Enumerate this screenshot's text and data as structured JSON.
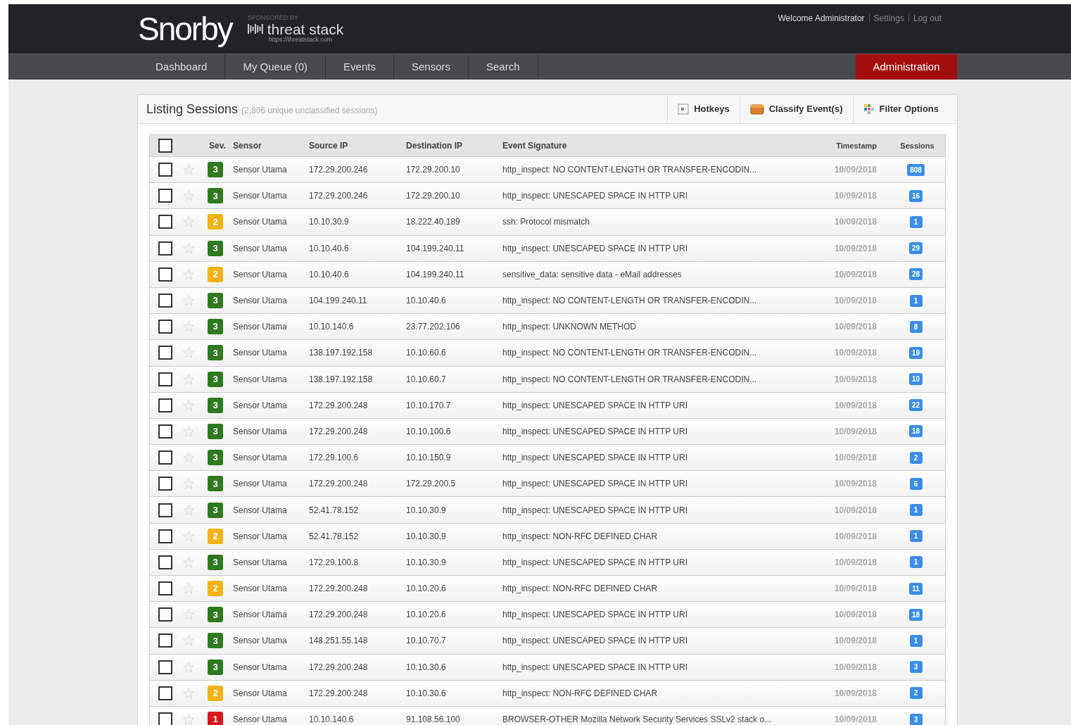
{
  "header": {
    "logo": "Snorby",
    "sponsor_caption": "SPONSORED BY",
    "sponsor_name": "threat stack",
    "sponsor_url": "https://threatstack.com",
    "user_links": [
      "Welcome Administrator",
      "Settings",
      "Log out"
    ]
  },
  "nav": [
    {
      "label": "Dashboard",
      "kind": "tab"
    },
    {
      "label": "My Queue (0)",
      "kind": "tab"
    },
    {
      "label": "Events",
      "kind": "tab"
    },
    {
      "label": "Sensors",
      "kind": "tab"
    },
    {
      "label": "Search",
      "kind": "tab"
    },
    {
      "label": "Administration",
      "kind": "admin"
    }
  ],
  "panel": {
    "title": "Listing Sessions",
    "subtitle": "(2,806 unique unclassified sessions)",
    "actions": [
      {
        "label": "Hotkeys",
        "kind": "hotkeys"
      },
      {
        "label": "Classify Event(s)",
        "kind": "classify"
      },
      {
        "label": "Filter Options",
        "kind": "filter"
      }
    ]
  },
  "table": {
    "select_all_checked": false,
    "columns": [
      "Sev.",
      "Sensor",
      "Source IP",
      "Destination IP",
      "Event Signature",
      "Timestamp",
      "Sessions"
    ],
    "rows": [
      {
        "checked": false,
        "starred": false,
        "severity": {
          "label": "3",
          "color": "#2f7a1f"
        },
        "sensor": "Sensor Utama",
        "source": "172.29.200.246",
        "destination": "172.29.200.10",
        "signature": "http_inspect: NO CONTENT-LENGTH OR TRANSFER-ENCODIN...",
        "timestamp": "10/09/2018",
        "sessions": "808"
      },
      {
        "checked": false,
        "starred": false,
        "severity": {
          "label": "3",
          "color": "#2f7a1f"
        },
        "sensor": "Sensor Utama",
        "source": "172.29.200.246",
        "destination": "172.29.200.10",
        "signature": "http_inspect: UNESCAPED SPACE IN HTTP URI",
        "timestamp": "10/09/2018",
        "sessions": "16"
      },
      {
        "checked": false,
        "starred": false,
        "severity": {
          "label": "2",
          "color": "#f2b318"
        },
        "sensor": "Sensor Utama",
        "source": "10.10.30.9",
        "destination": "18.222.40.189",
        "signature": "ssh: Protocol mismatch",
        "timestamp": "10/09/2018",
        "sessions": "1"
      },
      {
        "checked": false,
        "starred": false,
        "severity": {
          "label": "3",
          "color": "#2f7a1f"
        },
        "sensor": "Sensor Utama",
        "source": "10.10.40.6",
        "destination": "104.199.240.11",
        "signature": "http_inspect: UNESCAPED SPACE IN HTTP URI",
        "timestamp": "10/09/2018",
        "sessions": "29"
      },
      {
        "checked": false,
        "starred": false,
        "severity": {
          "label": "2",
          "color": "#f2b318"
        },
        "sensor": "Sensor Utama",
        "source": "10.10.40.6",
        "destination": "104.199.240.11",
        "signature": "sensitive_data: sensitive data - eMail addresses",
        "timestamp": "10/09/2018",
        "sessions": "28"
      },
      {
        "checked": false,
        "starred": false,
        "severity": {
          "label": "3",
          "color": "#2f7a1f"
        },
        "sensor": "Sensor Utama",
        "source": "104.199.240.11",
        "destination": "10.10.40.6",
        "signature": "http_inspect: NO CONTENT-LENGTH OR TRANSFER-ENCODIN...",
        "timestamp": "10/09/2018",
        "sessions": "1"
      },
      {
        "checked": false,
        "starred": false,
        "severity": {
          "label": "3",
          "color": "#2f7a1f"
        },
        "sensor": "Sensor Utama",
        "source": "10.10.140.6",
        "destination": "23.77.202.106",
        "signature": "http_inspect: UNKNOWN METHOD",
        "timestamp": "10/09/2018",
        "sessions": "8"
      },
      {
        "checked": false,
        "starred": false,
        "severity": {
          "label": "3",
          "color": "#2f7a1f"
        },
        "sensor": "Sensor Utama",
        "source": "138.197.192.158",
        "destination": "10.10.60.6",
        "signature": "http_inspect: NO CONTENT-LENGTH OR TRANSFER-ENCODIN...",
        "timestamp": "10/09/2018",
        "sessions": "19"
      },
      {
        "checked": false,
        "starred": false,
        "severity": {
          "label": "3",
          "color": "#2f7a1f"
        },
        "sensor": "Sensor Utama",
        "source": "138.197.192.158",
        "destination": "10.10.60.7",
        "signature": "http_inspect: NO CONTENT-LENGTH OR TRANSFER-ENCODIN...",
        "timestamp": "10/09/2018",
        "sessions": "10"
      },
      {
        "checked": false,
        "starred": false,
        "severity": {
          "label": "3",
          "color": "#2f7a1f"
        },
        "sensor": "Sensor Utama",
        "source": "172.29.200.248",
        "destination": "10.10.170.7",
        "signature": "http_inspect: UNESCAPED SPACE IN HTTP URI",
        "timestamp": "10/09/2018",
        "sessions": "22"
      },
      {
        "checked": false,
        "starred": false,
        "severity": {
          "label": "3",
          "color": "#2f7a1f"
        },
        "sensor": "Sensor Utama",
        "source": "172.29.200.248",
        "destination": "10.10.100.6",
        "signature": "http_inspect: UNESCAPED SPACE IN HTTP URI",
        "timestamp": "10/09/2018",
        "sessions": "18"
      },
      {
        "checked": false,
        "starred": false,
        "severity": {
          "label": "3",
          "color": "#2f7a1f"
        },
        "sensor": "Sensor Utama",
        "source": "172.29.100.6",
        "destination": "10.10.150.9",
        "signature": "http_inspect: UNESCAPED SPACE IN HTTP URI",
        "timestamp": "10/09/2018",
        "sessions": "2"
      },
      {
        "checked": false,
        "starred": false,
        "severity": {
          "label": "3",
          "color": "#2f7a1f"
        },
        "sensor": "Sensor Utama",
        "source": "172.29.200.248",
        "destination": "172.29.200.5",
        "signature": "http_inspect: UNESCAPED SPACE IN HTTP URI",
        "timestamp": "10/09/2018",
        "sessions": "6"
      },
      {
        "checked": false,
        "starred": false,
        "severity": {
          "label": "3",
          "color": "#2f7a1f"
        },
        "sensor": "Sensor Utama",
        "source": "52.41.78.152",
        "destination": "10.10.30.9",
        "signature": "http_inspect: UNESCAPED SPACE IN HTTP URI",
        "timestamp": "10/09/2018",
        "sessions": "1"
      },
      {
        "checked": false,
        "starred": false,
        "severity": {
          "label": "2",
          "color": "#f2b318"
        },
        "sensor": "Sensor Utama",
        "source": "52.41.78.152",
        "destination": "10.10.30.9",
        "signature": "http_inspect: NON-RFC DEFINED CHAR",
        "timestamp": "10/09/2018",
        "sessions": "1"
      },
      {
        "checked": false,
        "starred": false,
        "severity": {
          "label": "3",
          "color": "#2f7a1f"
        },
        "sensor": "Sensor Utama",
        "source": "172.29.100.8",
        "destination": "10.10.30.9",
        "signature": "http_inspect: UNESCAPED SPACE IN HTTP URI",
        "timestamp": "10/09/2018",
        "sessions": "1"
      },
      {
        "checked": false,
        "starred": false,
        "severity": {
          "label": "2",
          "color": "#f2b318"
        },
        "sensor": "Sensor Utama",
        "source": "172.29.200.248",
        "destination": "10.10.20.6",
        "signature": "http_inspect: NON-RFC DEFINED CHAR",
        "timestamp": "10/09/2018",
        "sessions": "11"
      },
      {
        "checked": false,
        "starred": false,
        "severity": {
          "label": "3",
          "color": "#2f7a1f"
        },
        "sensor": "Sensor Utama",
        "source": "172.29.200.248",
        "destination": "10.10.20.6",
        "signature": "http_inspect: UNESCAPED SPACE IN HTTP URI",
        "timestamp": "10/09/2018",
        "sessions": "18"
      },
      {
        "checked": false,
        "starred": false,
        "severity": {
          "label": "3",
          "color": "#2f7a1f"
        },
        "sensor": "Sensor Utama",
        "source": "148.251.55.148",
        "destination": "10.10.70.7",
        "signature": "http_inspect: UNESCAPED SPACE IN HTTP URI",
        "timestamp": "10/09/2018",
        "sessions": "1"
      },
      {
        "checked": false,
        "starred": false,
        "severity": {
          "label": "3",
          "color": "#2f7a1f"
        },
        "sensor": "Sensor Utama",
        "source": "172.29.200.248",
        "destination": "10.10.30.6",
        "signature": "http_inspect: UNESCAPED SPACE IN HTTP URI",
        "timestamp": "10/09/2018",
        "sessions": "3"
      },
      {
        "checked": false,
        "starred": false,
        "severity": {
          "label": "2",
          "color": "#f2b318"
        },
        "sensor": "Sensor Utama",
        "source": "172.29.200.248",
        "destination": "10.10.30.6",
        "signature": "http_inspect: NON-RFC DEFINED CHAR",
        "timestamp": "10/09/2018",
        "sessions": "2"
      },
      {
        "checked": false,
        "starred": false,
        "severity": {
          "label": "1",
          "color": "#d8171c"
        },
        "sensor": "Sensor Utama",
        "source": "10.10.140.6",
        "destination": "91.108.56.100",
        "signature": "BROWSER-OTHER Mozilla Network Security Services SSLv2 stack o...",
        "timestamp": "10/09/2018",
        "sessions": "3"
      }
    ]
  }
}
